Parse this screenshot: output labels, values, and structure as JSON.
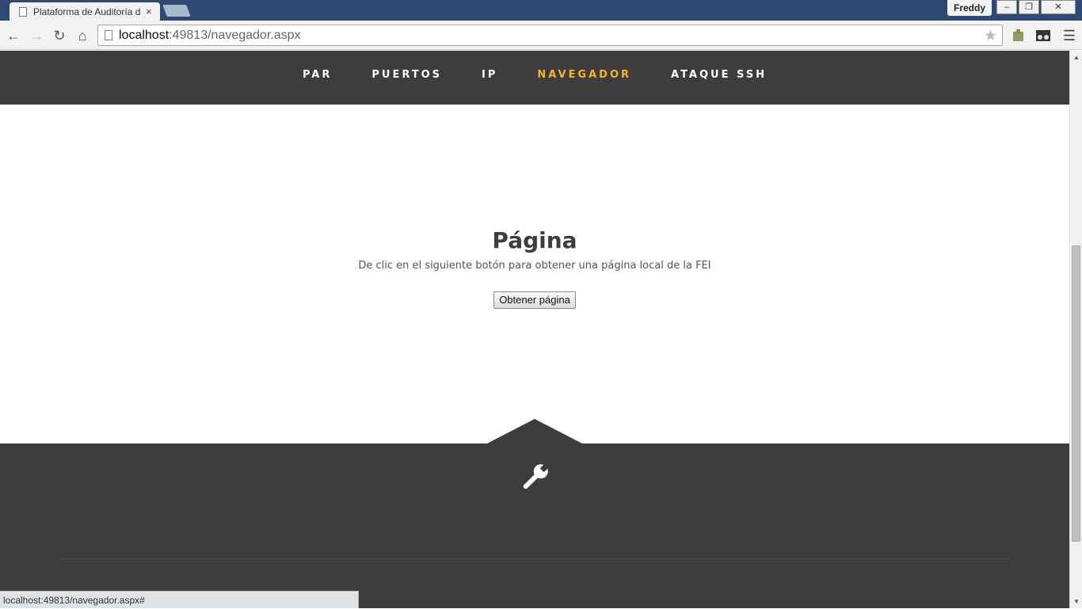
{
  "browser": {
    "tab_title": "Plataforma de Auditoría d",
    "tab_close": "×",
    "profile_name": "Freddy",
    "window_buttons": {
      "minimize": "–",
      "restore": "❐",
      "close": "✕"
    },
    "nav_buttons": {
      "back": "←",
      "forward": "→",
      "reload": "↻",
      "home": "⌂"
    },
    "url_host": "localhost",
    "url_rest": ":49813/navegador.aspx",
    "bookmark_star": "★",
    "menu_icon": "☰"
  },
  "nav": {
    "items": [
      {
        "label": "PAR"
      },
      {
        "label": "PUERTOS"
      },
      {
        "label": "IP"
      },
      {
        "label": "NAVEGADOR",
        "active": true
      },
      {
        "label": "ATAQUE SSH"
      }
    ],
    "active_color": "#f5b42a",
    "bg_color": "#3d3d3d"
  },
  "main": {
    "heading": "Página",
    "description": "De clic en el siguiente botón para obtener una página local de la FEI",
    "button_label": "Obtener página"
  },
  "footer": {
    "icon": "wrench-icon"
  },
  "status_bar": {
    "text": "localhost:49813/navegador.aspx#"
  }
}
